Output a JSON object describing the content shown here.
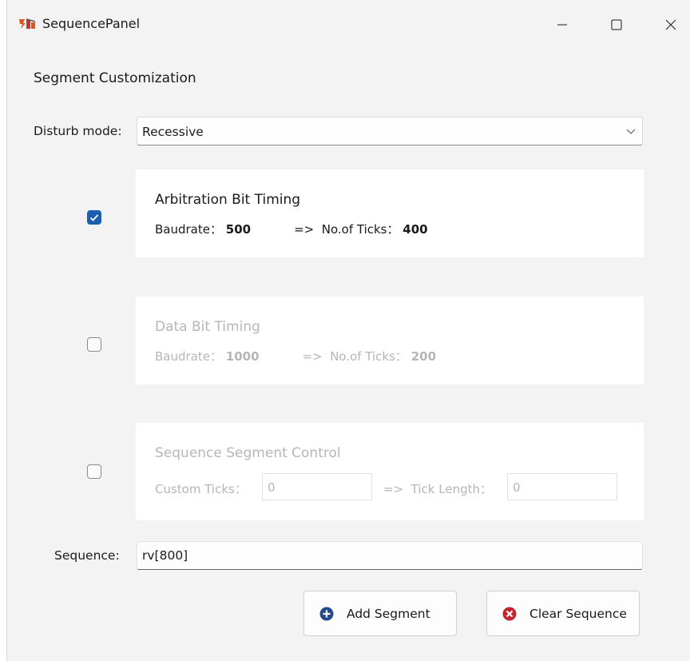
{
  "window": {
    "title": "SequencePanel",
    "app_icon": "app-logo-icon",
    "controls": {
      "minimize": "minimize-icon",
      "maximize": "maximize-icon",
      "close": "close-icon"
    }
  },
  "main": {
    "section_title": "Segment Customization",
    "disturb_mode_label": "Disturb mode:",
    "disturb_mode_value": "Recessive",
    "arbitration": {
      "checked": true,
      "title": "Arbitration Bit Timing",
      "baudrate_label": "Baudrate：",
      "baudrate_value": "500",
      "ticks_label": "=>  No.of Ticks：",
      "ticks_value": "400"
    },
    "data_bit": {
      "checked": false,
      "title": "Data Bit Timing",
      "baudrate_label": "Baudrate：",
      "baudrate_value": "1000",
      "ticks_label": "=>  No.of Ticks：",
      "ticks_value": "200"
    },
    "segment_control": {
      "checked": false,
      "title": "Sequence Segment Control",
      "custom_ticks_label": "Custom Ticks：",
      "custom_ticks_value": "0",
      "tick_length_label": "=>  Tick Length：",
      "tick_length_value": "0"
    },
    "sequence_label": "Sequence:",
    "sequence_value": "rv[800]",
    "add_segment_label": "Add Segment",
    "clear_sequence_label": "Clear Sequence"
  },
  "colors": {
    "accent": "#1b5fae",
    "add_icon": "#234a8a",
    "clear_icon": "#c4242f",
    "disabled_text": "#b6b6b6"
  }
}
